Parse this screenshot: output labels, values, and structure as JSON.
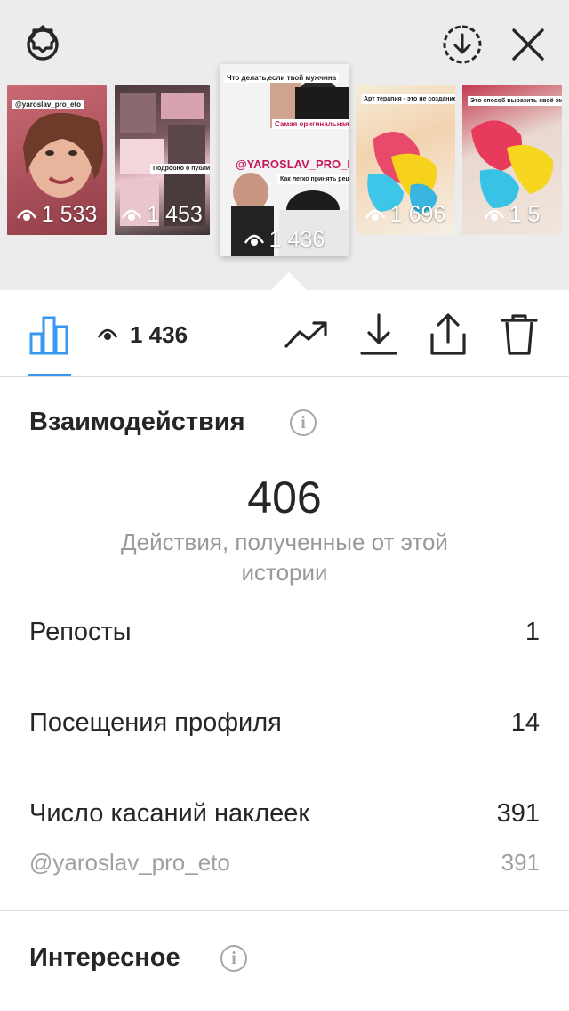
{
  "stories": [
    {
      "views": "1 533",
      "caption": "@yaroslav_pro_eto"
    },
    {
      "views": "1 453",
      "caption": "Подробно о публичности"
    },
    {
      "views": "1 436",
      "caption_top": "Что делать,если твой мужчина",
      "caption_mid": "Самая оригинальная техника минета",
      "caption_handle": "@YAROSLAV_PRO_ETO",
      "caption_bottom": "Как легко принять решение уйти от мудака!"
    },
    {
      "views": "1 696",
      "caption": "Арт терапия - это не создание художественного произведения"
    },
    {
      "views": "1 5",
      "caption": "Это способ выразить своё эмоциональное состояние"
    }
  ],
  "toolbar": {
    "selected_views": "1 436"
  },
  "interactions": {
    "title": "Взаимодействия",
    "total": "406",
    "total_caption": "Действия, полученные от этой истории",
    "rows": [
      {
        "label": "Репосты",
        "value": "1"
      },
      {
        "label": "Посещения профиля",
        "value": "14"
      },
      {
        "label": "Число касаний наклеек",
        "value": "391"
      }
    ],
    "sticker_sub": {
      "label": "@yaroslav_pro_eto",
      "value": "391"
    }
  },
  "discovery": {
    "title": "Интересное"
  },
  "colors": {
    "accent": "#3897f0",
    "text": "#262626",
    "muted": "#999999",
    "top_background": "#ececec"
  }
}
